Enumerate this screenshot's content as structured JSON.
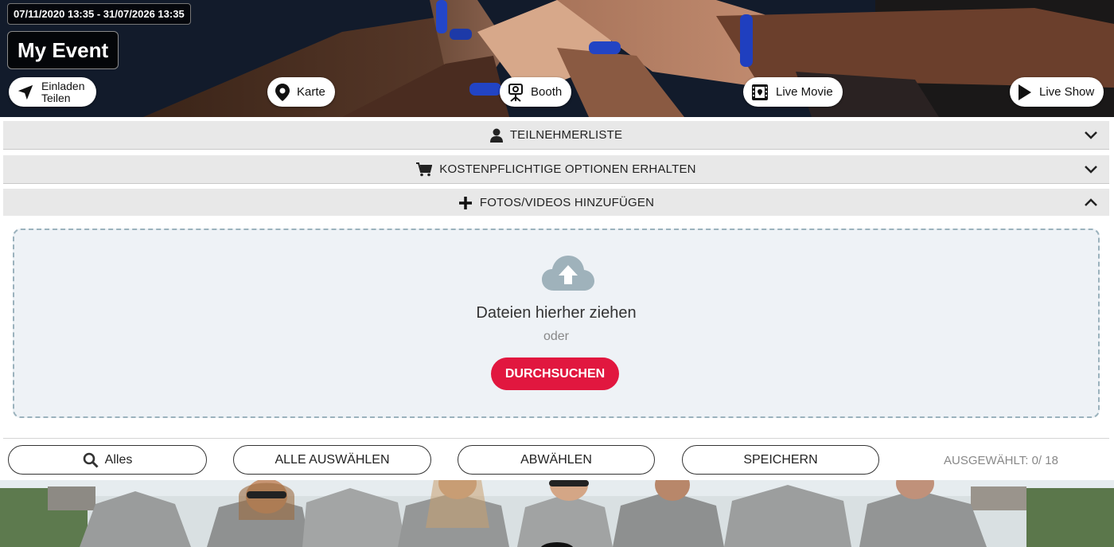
{
  "event": {
    "date_range": "07/11/2020 13:35 - 31/07/2026 13:35",
    "title": "My Event"
  },
  "hero_actions": {
    "invite_line1": "Einladen",
    "invite_line2": "Teilen",
    "map": "Karte",
    "booth": "Booth",
    "live_movie": "Live Movie",
    "live_show": "Live Show"
  },
  "accordion": [
    {
      "label": "TEILNEHMERLISTE",
      "icon": "user-icon",
      "expanded": false
    },
    {
      "label": "KOSTENPFLICHTIGE OPTIONEN ERHALTEN",
      "icon": "cart-icon",
      "expanded": false
    },
    {
      "label": "FOTOS/VIDEOS HINZUFÜGEN",
      "icon": "plus-icon",
      "expanded": true
    }
  ],
  "upload": {
    "drop_text": "Dateien hierher ziehen",
    "or_text": "oder",
    "browse_label": "DURCHSUCHEN"
  },
  "toolbar": {
    "filter_label": "Alles",
    "select_all_label": "ALLE AUSWÄHLEN",
    "deselect_label": "ABWÄHLEN",
    "save_label": "SPEICHERN",
    "selected_counter": "AUSGEWÄHLT: 0/ 18"
  },
  "colors": {
    "accent": "#e1173f",
    "accordion_bg": "#e8e8e8",
    "dropzone_bg": "#eef2f6",
    "dropzone_border": "#9bb2bd"
  }
}
